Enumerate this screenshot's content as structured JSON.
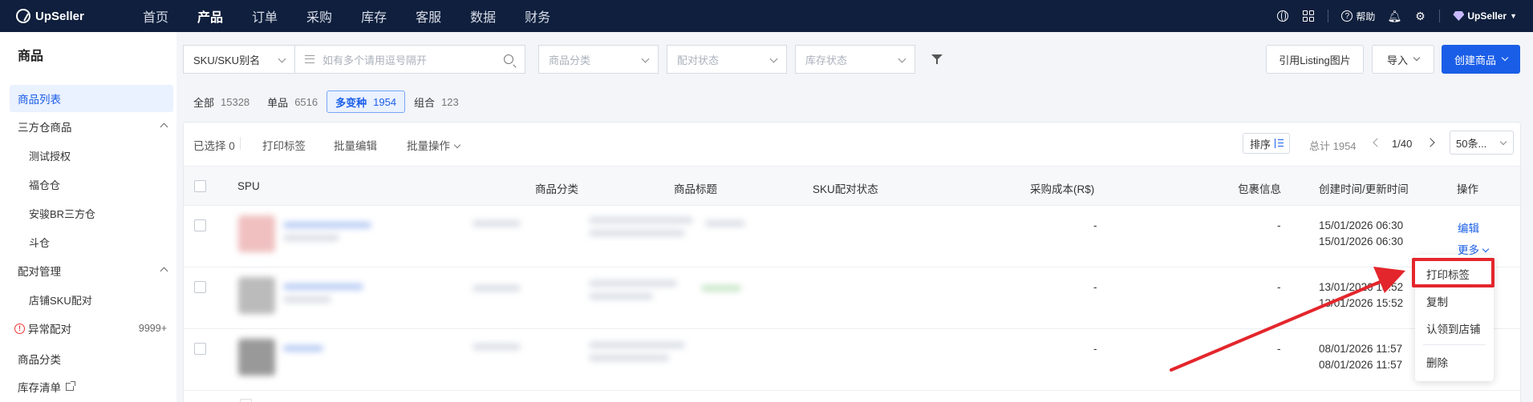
{
  "app": {
    "name": "UpSeller"
  },
  "topnav": {
    "items": [
      "首页",
      "产品",
      "订单",
      "采购",
      "库存",
      "客服",
      "数据",
      "财务"
    ],
    "active_index": 1,
    "help_label": "帮助",
    "user_name": "UpSeller"
  },
  "sidebar": {
    "title": "商品",
    "items": [
      {
        "label": "商品列表"
      },
      {
        "label": "三方仓商品"
      },
      {
        "label": "测试授权"
      },
      {
        "label": "福仓仓"
      },
      {
        "label": "安骏BR三方仓"
      },
      {
        "label": "斗仓"
      },
      {
        "label": "配对管理"
      },
      {
        "label": "店铺SKU配对"
      },
      {
        "label": "异常配对",
        "count": "9999+"
      },
      {
        "label": "商品分类"
      },
      {
        "label": "库存清单"
      }
    ]
  },
  "filters": {
    "sku_type": "SKU/SKU别名",
    "search_placeholder": "如有多个请用逗号隔开",
    "category_placeholder": "商品分类",
    "pair_status_placeholder": "配对状态",
    "stock_status_placeholder": "库存状态"
  },
  "actions": {
    "listing_images": "引用Listing图片",
    "import": "导入",
    "create": "创建商品"
  },
  "type_tabs": [
    {
      "label": "全部",
      "count": "15328"
    },
    {
      "label": "单品",
      "count": "6516"
    },
    {
      "label": "多变种",
      "count": "1954"
    },
    {
      "label": "组合",
      "count": "123"
    }
  ],
  "toolbar": {
    "selected_label": "已选择",
    "selected_count": "0",
    "print_label": "打印标签",
    "batch_edit": "批量编辑",
    "batch_ops": "批量操作",
    "sort_label": "排序",
    "total": "总计 1954",
    "page": "1/40",
    "page_size": "50条..."
  },
  "table": {
    "headers": [
      "SPU",
      "商品分类",
      "商品标题",
      "SKU配对状态",
      "采购成本(R$)",
      "包裹信息",
      "创建时间/更新时间",
      "操作"
    ],
    "rows": [
      {
        "cost": "-",
        "package": "-",
        "created": "15/01/2026 06:30",
        "updated": "15/01/2026 06:30",
        "edit": "编辑",
        "more": "更多"
      },
      {
        "cost": "-",
        "package": "-",
        "created": "13/01/2026 15:52",
        "updated": "13/01/2026 15:52"
      },
      {
        "cost": "-",
        "package": "-",
        "created": "08/01/2026 11:57",
        "updated": "08/01/2026 11:57"
      }
    ]
  },
  "more_menu": {
    "items": [
      "打印标签",
      "复制",
      "认领到店铺",
      "删除"
    ]
  },
  "colors": {
    "brand": "#1a5ee8",
    "nav_bg": "#0f1f3d",
    "annotation": "#e3262c"
  }
}
